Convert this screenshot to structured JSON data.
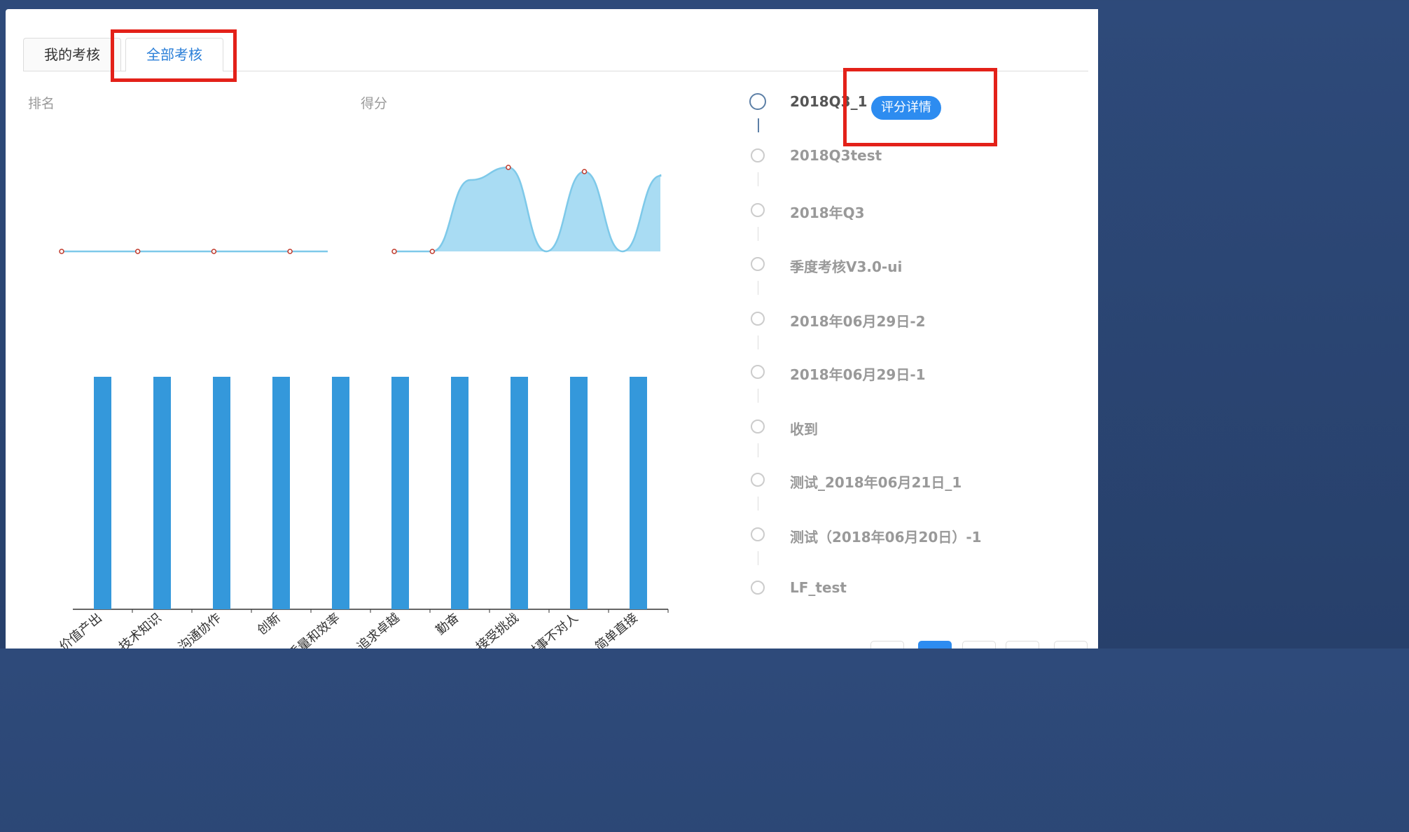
{
  "tabs": [
    {
      "label": "我的考核"
    },
    {
      "label": "全部考核"
    }
  ],
  "charts": {
    "rank_title": "排名",
    "score_title": "得分"
  },
  "chart_data": [
    {
      "type": "line",
      "name": "rank",
      "points": [
        0,
        0,
        0,
        0
      ]
    },
    {
      "type": "area",
      "name": "score",
      "points": [
        0,
        0,
        0.85,
        1.0,
        0,
        0.95,
        0,
        0.9
      ]
    },
    {
      "type": "bar",
      "categories": [
        "价值产出",
        "技术知识",
        "沟通协作",
        "创新",
        "质量和效率",
        "追求卓越",
        "勤奋",
        "接受挑战",
        "对事不对人",
        "简单直接"
      ],
      "values": [
        1,
        1,
        1,
        1,
        1,
        1,
        1,
        1,
        1,
        1
      ]
    }
  ],
  "timeline": {
    "items": [
      {
        "label": "2018Q3_1",
        "active": true
      },
      {
        "label": "2018Q3test"
      },
      {
        "label": "2018年Q3"
      },
      {
        "label": "季度考核V3.0-ui"
      },
      {
        "label": "2018年06月29日-2"
      },
      {
        "label": "2018年06月29日-1"
      },
      {
        "label": "收到"
      },
      {
        "label": "测试_2018年06月21日_1"
      },
      {
        "label": "测试（2018年06月20日）-1"
      },
      {
        "label": "LF_test"
      }
    ],
    "detail_button": "评分详情"
  },
  "colors": {
    "accent": "#2d8cf0",
    "bar": "#3498db",
    "area": "#a9dcf3",
    "highlight": "#e32119"
  }
}
